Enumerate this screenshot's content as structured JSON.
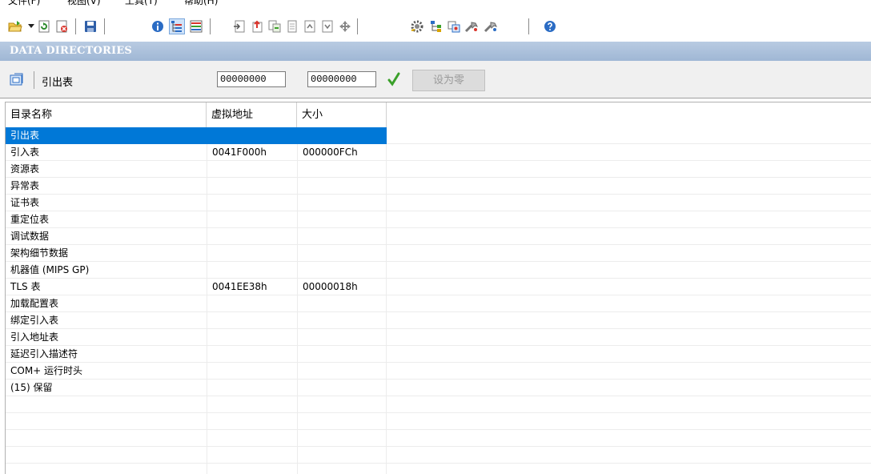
{
  "menubar": {
    "items": [
      "文件(F)",
      "视图(V)",
      "工具(T)",
      "帮助(H)"
    ]
  },
  "toolbar": {
    "icons": [
      "open-folder-icon",
      "dropdown-arrow-icon",
      "refresh-icon",
      "close-file-icon",
      "save-icon",
      "info-icon",
      "tree-view-icon",
      "table-view-icon",
      "import-icon",
      "export-icon",
      "compare-icon",
      "page-icon",
      "page-up-icon",
      "page-down-icon",
      "navigate-icon",
      "settings-gear-icon",
      "structure-icon",
      "resource-icon",
      "tools-icon",
      "tools-alt-icon",
      "help-icon"
    ]
  },
  "section": {
    "title": "DATA DIRECTORIES"
  },
  "editor": {
    "label": "引出表",
    "rva_value": "00000000",
    "size_value": "00000000",
    "zero_button": "设为零"
  },
  "table": {
    "columns": [
      "目录名称",
      "虚拟地址",
      "大小"
    ],
    "rows": [
      {
        "name": "引出表",
        "rva": "",
        "size": "",
        "selected": true
      },
      {
        "name": "引入表",
        "rva": "0041F000h",
        "size": "000000FCh"
      },
      {
        "name": "资源表",
        "rva": "",
        "size": ""
      },
      {
        "name": "异常表",
        "rva": "",
        "size": ""
      },
      {
        "name": "证书表",
        "rva": "",
        "size": ""
      },
      {
        "name": "重定位表",
        "rva": "",
        "size": ""
      },
      {
        "name": "调试数据",
        "rva": "",
        "size": ""
      },
      {
        "name": "架构细节数据",
        "rva": "",
        "size": ""
      },
      {
        "name": "机器值 (MIPS GP)",
        "rva": "",
        "size": ""
      },
      {
        "name": "TLS 表",
        "rva": "0041EE38h",
        "size": "00000018h"
      },
      {
        "name": "加载配置表",
        "rva": "",
        "size": ""
      },
      {
        "name": "绑定引入表",
        "rva": "",
        "size": ""
      },
      {
        "name": "引入地址表",
        "rva": "",
        "size": ""
      },
      {
        "name": "延迟引入描述符",
        "rva": "",
        "size": ""
      },
      {
        "name": "COM+ 运行时头",
        "rva": "",
        "size": ""
      },
      {
        "name": "(15) 保留",
        "rva": "",
        "size": ""
      },
      {
        "name": "",
        "rva": "",
        "size": ""
      },
      {
        "name": "",
        "rva": "",
        "size": ""
      },
      {
        "name": "",
        "rva": "",
        "size": ""
      },
      {
        "name": "",
        "rva": "",
        "size": ""
      },
      {
        "name": "",
        "rva": "",
        "size": ""
      }
    ]
  },
  "colors": {
    "selection": "#0078d7",
    "header_band": "#a9bfdb",
    "check": "#3aa02a"
  }
}
